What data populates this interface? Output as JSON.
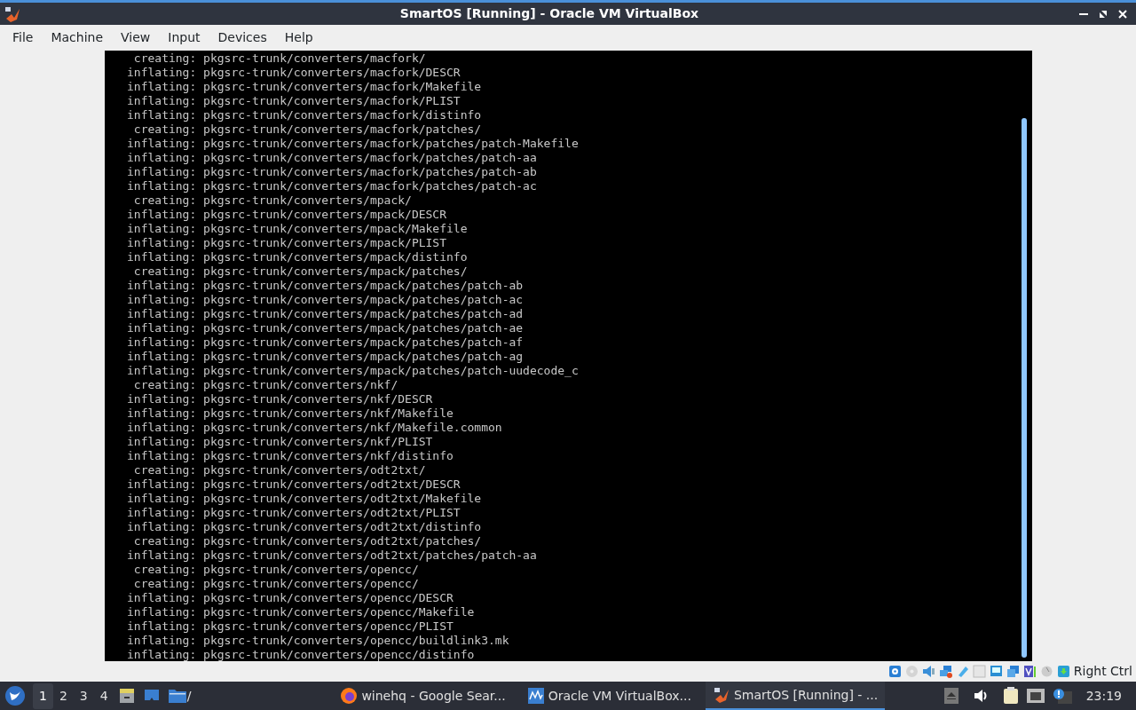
{
  "window": {
    "title": "SmartOS [Running] - Oracle VM VirtualBox"
  },
  "menu": [
    "File",
    "Machine",
    "View",
    "Input",
    "Devices",
    "Help"
  ],
  "terminal": {
    "lines": [
      {
        "text": " creating: pkgsrc-trunk/converters/macfork/"
      },
      {
        "text": "inflating: pkgsrc-trunk/converters/macfork/DESCR"
      },
      {
        "text": "inflating: pkgsrc-trunk/converters/macfork/Makefile"
      },
      {
        "text": "inflating: pkgsrc-trunk/converters/macfork/PLIST"
      },
      {
        "text": "inflating: pkgsrc-trunk/converters/macfork/distinfo"
      },
      {
        "text": " creating: pkgsrc-trunk/converters/macfork/patches/"
      },
      {
        "text": "inflating: pkgsrc-trunk/converters/macfork/patches/patch-Makefile"
      },
      {
        "text": "inflating: pkgsrc-trunk/converters/macfork/patches/patch-aa"
      },
      {
        "text": "inflating: pkgsrc-trunk/converters/macfork/patches/patch-ab"
      },
      {
        "text": "inflating: pkgsrc-trunk/converters/macfork/patches/patch-ac"
      },
      {
        "text": " creating: pkgsrc-trunk/converters/mpack/"
      },
      {
        "text": "inflating: pkgsrc-trunk/converters/mpack/DESCR"
      },
      {
        "text": "inflating: pkgsrc-trunk/converters/mpack/Makefile"
      },
      {
        "text": "inflating: pkgsrc-trunk/converters/mpack/PLIST"
      },
      {
        "text": "inflating: pkgsrc-trunk/converters/mpack/distinfo"
      },
      {
        "text": " creating: pkgsrc-trunk/converters/mpack/patches/"
      },
      {
        "text": "inflating: pkgsrc-trunk/converters/mpack/patches/patch-ab"
      },
      {
        "text": "inflating: pkgsrc-trunk/converters/mpack/patches/patch-ac"
      },
      {
        "text": "inflating: pkgsrc-trunk/converters/mpack/patches/patch-ad"
      },
      {
        "text": "inflating: pkgsrc-trunk/converters/mpack/patches/patch-ae"
      },
      {
        "text": "inflating: pkgsrc-trunk/converters/mpack/patches/patch-af"
      },
      {
        "text": "inflating: pkgsrc-trunk/converters/mpack/patches/patch-ag"
      },
      {
        "text": "inflating: pkgsrc-trunk/converters/mpack/patches/patch-uudecode_c"
      },
      {
        "text": " creating: pkgsrc-trunk/converters/nkf/"
      },
      {
        "text": "inflating: pkgsrc-trunk/converters/nkf/DESCR"
      },
      {
        "text": "inflating: pkgsrc-trunk/converters/nkf/Makefile"
      },
      {
        "text": "inflating: pkgsrc-trunk/converters/nkf/Makefile.common"
      },
      {
        "text": "inflating: pkgsrc-trunk/converters/nkf/PLIST"
      },
      {
        "text": "inflating: pkgsrc-trunk/converters/nkf/distinfo"
      },
      {
        "text": " creating: pkgsrc-trunk/converters/odt2txt/"
      },
      {
        "text": "inflating: pkgsrc-trunk/converters/odt2txt/DESCR"
      },
      {
        "text": "inflating: pkgsrc-trunk/converters/odt2txt/Makefile"
      },
      {
        "text": "inflating: pkgsrc-trunk/converters/odt2txt/PLIST"
      },
      {
        "text": "inflating: pkgsrc-trunk/converters/odt2txt/distinfo"
      },
      {
        "text": " creating: pkgsrc-trunk/converters/odt2txt/patches/"
      },
      {
        "text": "inflating: pkgsrc-trunk/converters/odt2txt/patches/patch-aa"
      },
      {
        "text": " creating: pkgsrc-trunk/converters/opencc/"
      },
      {
        "text": " creating: pkgsrc-trunk/converters/opencc/"
      },
      {
        "text": "inflating: pkgsrc-trunk/converters/opencc/DESCR"
      },
      {
        "text": "inflating: pkgsrc-trunk/converters/opencc/Makefile"
      },
      {
        "text": "inflating: pkgsrc-trunk/converters/opencc/PLIST"
      },
      {
        "text": "inflating: pkgsrc-trunk/converters/opencc/buildlink3.mk"
      },
      {
        "text": "inflating: pkgsrc-trunk/converters/opencc/distinfo"
      }
    ]
  },
  "status_bar": {
    "host_key": "Right Ctrl"
  },
  "taskbar": {
    "workspaces": [
      {
        "label": "1",
        "selected": true
      },
      {
        "label": "2",
        "selected": false
      },
      {
        "label": "3",
        "selected": false
      },
      {
        "label": "4",
        "selected": false
      }
    ],
    "folder_label": "/",
    "tasks": [
      {
        "kind": "browser",
        "label": "winehq - Google Sear...",
        "selected": false
      },
      {
        "kind": "manager",
        "label": "Oracle VM VirtualBox...",
        "selected": false
      },
      {
        "kind": "vm",
        "label": "SmartOS [Running] - ...",
        "selected": true
      }
    ],
    "clock": "23:19"
  }
}
